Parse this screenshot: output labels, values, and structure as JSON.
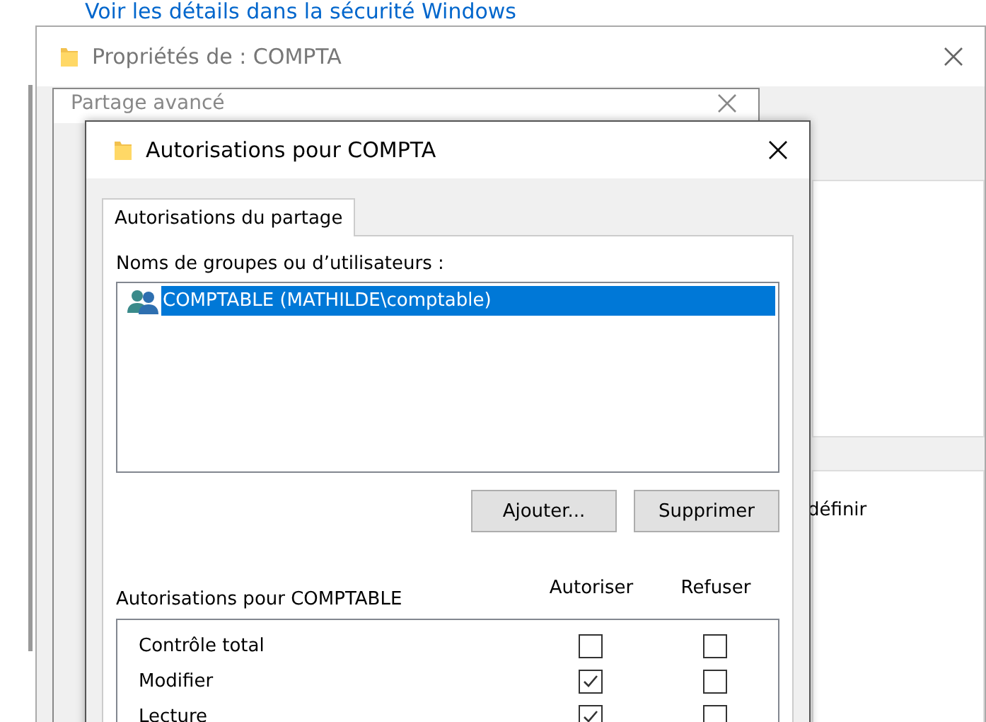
{
  "background_link": "Voir les détails dans la sécurité Windows",
  "properties_window": {
    "title": "Propriétés de : COMPTA",
    "side_text": "définir"
  },
  "advanced_window": {
    "title": "Partage avancé"
  },
  "dialog": {
    "title": "Autorisations pour COMPTA",
    "tabs": [
      {
        "label": "Autorisations du partage",
        "selected": true
      }
    ],
    "users_label": "Noms de groupes ou d’utilisateurs :",
    "users": [
      {
        "name": "COMPTABLE (MATHILDE\\comptable)",
        "selected": true
      }
    ],
    "buttons": [
      "Ajouter...",
      "Supprimer"
    ],
    "permissions_label": "Autorisations pour COMPTABLE",
    "columns": [
      "Autoriser",
      "Refuser"
    ],
    "permissions": [
      {
        "name": "Contrôle total",
        "allow": false,
        "deny": false
      },
      {
        "name": "Modifier",
        "allow": true,
        "deny": false
      },
      {
        "name": "Lecture",
        "allow": true,
        "deny": false
      }
    ]
  }
}
